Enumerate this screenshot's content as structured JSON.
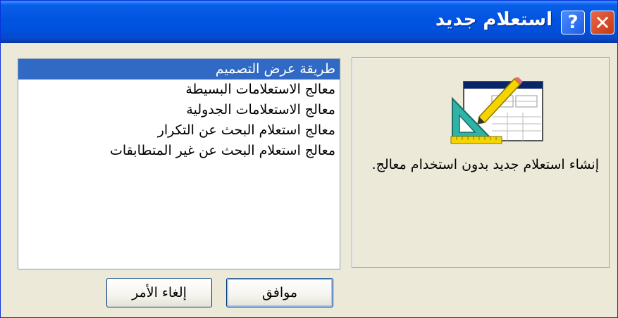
{
  "window": {
    "title": "استعلام جديد",
    "help_label": "?",
    "close_label": "✕"
  },
  "description": "إنشاء استعلام جديد بدون استخدام معالج.",
  "wizard_list": {
    "items": [
      {
        "label": "طريقة عرض التصميم",
        "selected": true
      },
      {
        "label": "معالج الاستعلامات البسيطة",
        "selected": false
      },
      {
        "label": "معالج الاستعلامات الجدولية",
        "selected": false
      },
      {
        "label": "معالج استعلام البحث عن التكرار",
        "selected": false
      },
      {
        "label": "معالج استعلام البحث عن غير المتطابقات",
        "selected": false
      }
    ]
  },
  "buttons": {
    "ok_label": "موافق",
    "cancel_label": "إلغاء الأمر"
  },
  "colors": {
    "titlebar": "#0053e1",
    "selection": "#316ac5",
    "face": "#ece9d8"
  }
}
